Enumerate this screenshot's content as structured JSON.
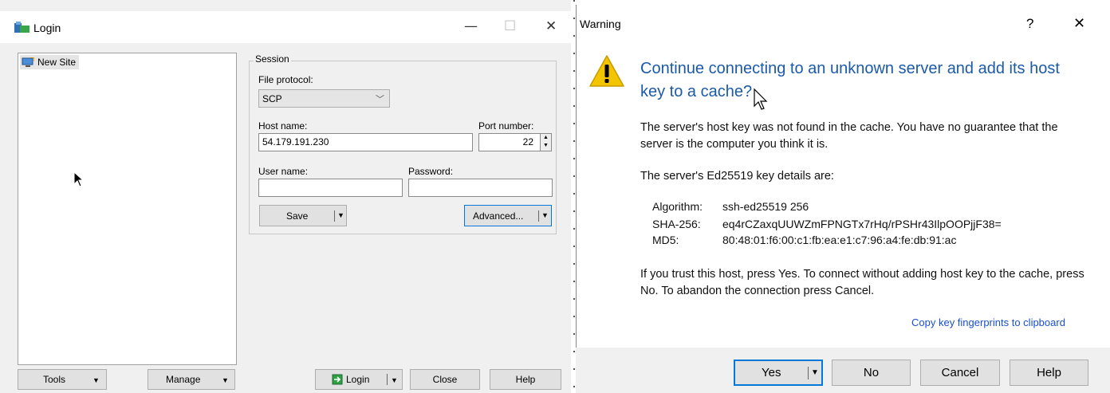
{
  "login": {
    "title": "Login",
    "sites": [
      "New Site"
    ],
    "session": {
      "legend": "Session",
      "file_protocol_label": "File protocol:",
      "file_protocol_value": "SCP",
      "host_label": "Host name:",
      "host_value": "54.179.191.230",
      "port_label": "Port number:",
      "port_value": "22",
      "user_label": "User name:",
      "user_value": "",
      "password_label": "Password:",
      "password_value": ""
    },
    "buttons": {
      "save": "Save",
      "advanced": "Advanced...",
      "tools": "Tools",
      "manage": "Manage",
      "login": "Login",
      "close": "Close",
      "help": "Help"
    }
  },
  "warning": {
    "title": "Warning",
    "help_glyph": "?",
    "close_glyph": "✕",
    "heading": "Continue connecting to an unknown server and add its host key to a cache?",
    "paragraph1": "The server's host key was not found in the cache. You have no guarantee that the server is the computer you think it is.",
    "paragraph2": "The server's Ed25519 key details are:",
    "details": [
      {
        "key": "Algorithm:",
        "value": "ssh-ed25519 256"
      },
      {
        "key": "SHA-256:",
        "value": "eq4rCZaxqUUWZmFPNGTx7rHq/rPSHr43IlpOOPjjF38="
      },
      {
        "key": "MD5:",
        "value": "80:48:01:f6:00:c1:fb:ea:e1:c7:96:a4:fe:db:91:ac"
      }
    ],
    "paragraph3": "If you trust this host, press Yes. To connect without adding host key to the cache, press No. To abandon the connection press Cancel.",
    "copy_link": "Copy key fingerprints to clipboard",
    "buttons": {
      "yes": "Yes",
      "no": "No",
      "cancel": "Cancel",
      "help": "Help"
    }
  },
  "colors": {
    "heading": "#1c5aa8",
    "link": "#1a4fcf",
    "warning_icon": "#f2c500"
  }
}
